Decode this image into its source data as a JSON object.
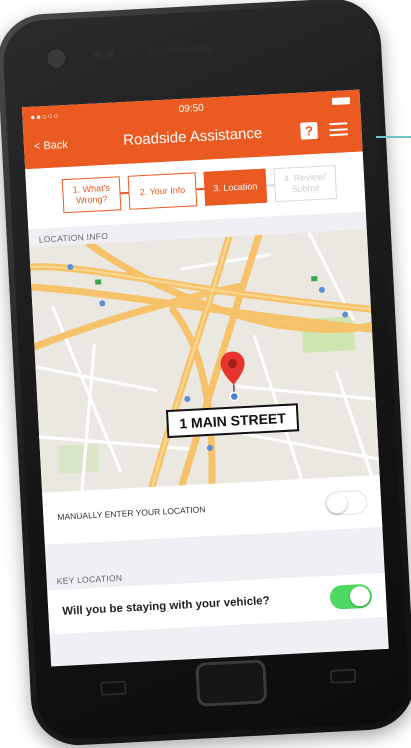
{
  "status_bar": {
    "carrier": "●●○○○",
    "time": "09:50"
  },
  "nav": {
    "back_label": "< Back",
    "title": "Roadside Assistance",
    "help_label": "?"
  },
  "steps": [
    {
      "line1": "1. What's",
      "line2": "Wrong?",
      "state": "done"
    },
    {
      "line1": "2. Your Info",
      "line2": "",
      "state": "done"
    },
    {
      "line1": "3. Location",
      "line2": "",
      "state": "active"
    },
    {
      "line1": "4. Review/",
      "line2": "Submit",
      "state": "pending"
    }
  ],
  "location_section": {
    "label": "LOCATION INFO"
  },
  "map": {
    "address_label": "1 MAIN STREET",
    "pin_color": "#e8322c"
  },
  "manual_entry": {
    "label": "MANUALLY ENTER YOUR LOCATION",
    "enabled": false
  },
  "key_location": {
    "label": "KEY LOCATION"
  },
  "stay_with_vehicle": {
    "question": "Will you be staying with your vehicle?",
    "enabled": true
  },
  "colors": {
    "accent": "#ea5a21",
    "toggle_on": "#4cd964",
    "highway": "#f7c86a"
  },
  "icons": [
    "camera-icon",
    "help-icon",
    "menu-icon",
    "map-pin-icon",
    "battery-icon",
    "home-button"
  ]
}
